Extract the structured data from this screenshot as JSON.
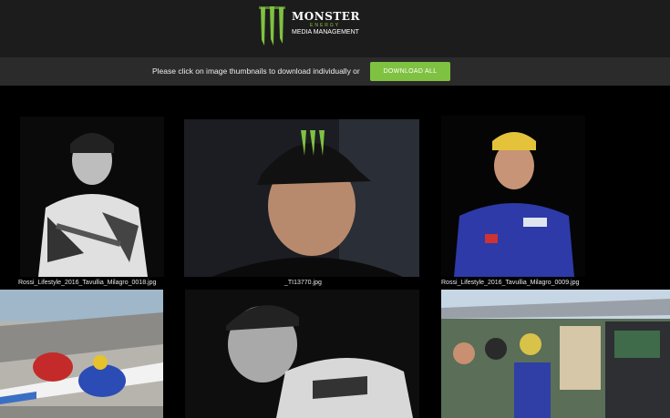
{
  "header": {
    "brand": "MONSTER",
    "brand_sub": "ENERGY",
    "subtitle": "MEDIA MANAGEMENT"
  },
  "toolbar": {
    "instruction": "Please click on image thumbnails to download individually or",
    "download_all_label": "DOWNLOAD ALL"
  },
  "gallery": {
    "items": [
      {
        "caption": "Rossi_Lifestyle_2016_Tavullia_Milagro_0018.jpg"
      },
      {
        "caption": "_TI13770.jpg"
      },
      {
        "caption": "Rossi_Lifestyle_2016_Tavullia_Milagro_0009.jpg"
      },
      {
        "caption": ""
      },
      {
        "caption": ""
      },
      {
        "caption": ""
      }
    ]
  },
  "colors": {
    "accent": "#7fc241",
    "header_bg": "#1c1c1c",
    "bar_bg": "#2b2b2b"
  }
}
